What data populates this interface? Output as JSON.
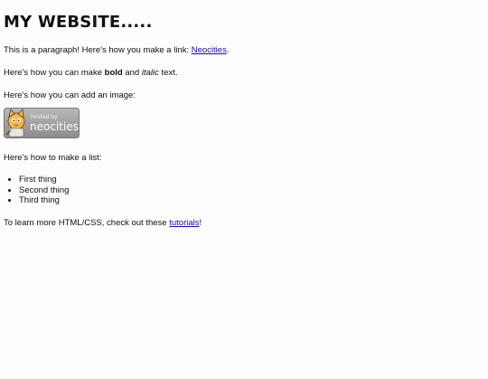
{
  "title": "MY WEBSITE.....",
  "para1": {
    "prefix": "This is a paragraph! Here's how you make a link: ",
    "link_text": "Neocities",
    "suffix": "."
  },
  "para2": {
    "prefix": "Here's how you can make ",
    "bold": "bold",
    "middle": " and ",
    "italic": "italic",
    "suffix": " text."
  },
  "para3": "Here's how you can add an image:",
  "badge": {
    "small_text": "hosted by",
    "big_text": "neocities",
    "icon": "neocities-cat-logo-icon"
  },
  "para4": "Here's how to make a list:",
  "list_items": [
    "First thing",
    "Second thing",
    "Third thing"
  ],
  "para5": {
    "prefix": "To learn more HTML/CSS, check out these ",
    "link_text": "tutorials",
    "suffix": "!"
  }
}
